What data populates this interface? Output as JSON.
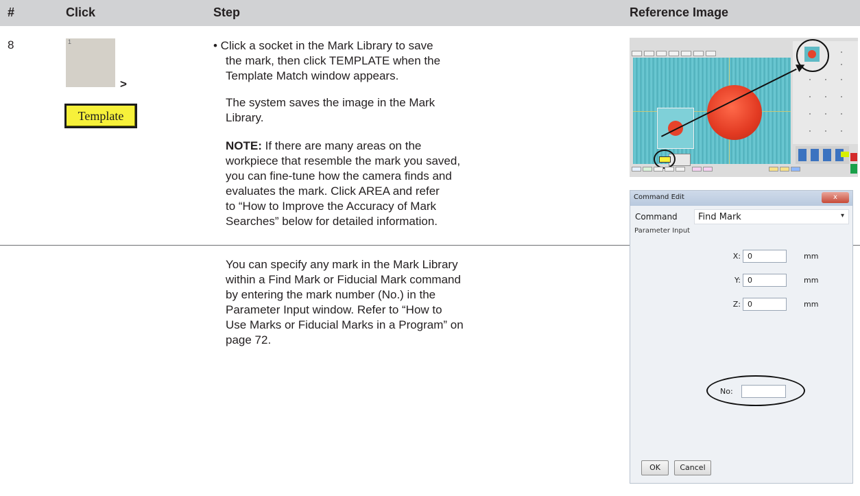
{
  "table": {
    "headers": [
      "#",
      "Click",
      "Step",
      "Reference Image"
    ]
  },
  "row1": {
    "number": "8",
    "socket_label": "1",
    "arrow_text": ">",
    "template_button": "Template",
    "paragraphs": {
      "p1_line1": "• Click a socket in the Mark Library to save",
      "p1_line2": "the mark, then click TEMPLATE when the",
      "p1_line3": "Template Match window appears.",
      "p2_line1": "The system saves the image in the Mark",
      "p2_line2": "Library.",
      "note_label": "NOTE:",
      "p3_line1": " If there are many areas on the",
      "p3_line2": "workpiece that resemble the mark you saved,",
      "p3_line3": "you can fine-tune how the camera finds and",
      "p3_line4": "evaluates the mark. Click AREA and refer",
      "p3_line5": "to “How to Improve the Accuracy of Mark",
      "p3_line6": "Searches” below for detailed information."
    }
  },
  "row2": {
    "lines": [
      "You can specify any mark in the Mark Library",
      "within a Find Mark or Fiducial Mark command",
      "by entering the mark number (No.) in the",
      "Parameter Input window. Refer to “How to",
      "Use Marks or Fiducial Marks in a Program” on",
      "page 72."
    ]
  },
  "command_edit": {
    "title": "Command Edit",
    "close_glyph": "x",
    "command_label": "Command",
    "command_value": "Find Mark",
    "dropdown_glyph": "▾",
    "group_label": "Parameter Input",
    "x_label": "X:",
    "x_value": "0",
    "y_label": "Y:",
    "y_value": "0",
    "z_label": "Z:",
    "z_value": "0",
    "unit": "mm",
    "no_label": "No:",
    "no_value": "",
    "ok": "OK",
    "cancel": "Cancel"
  },
  "colors": {
    "header_bg": "#d1d2d4",
    "template_yellow": "#f7f13a",
    "socket_gray": "#d4d0c8"
  }
}
